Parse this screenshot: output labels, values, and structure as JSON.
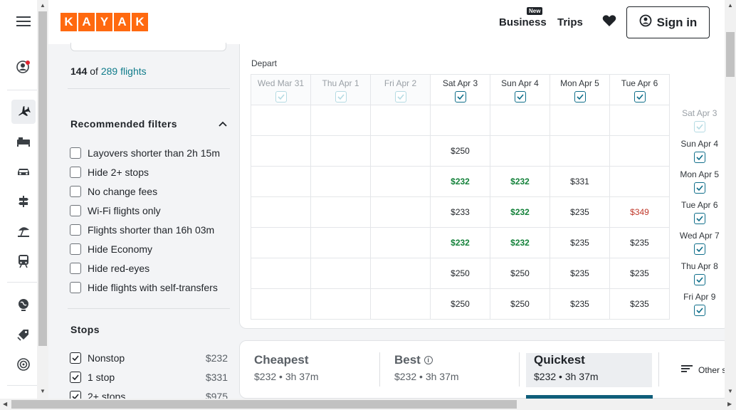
{
  "header": {
    "logo_letters": [
      "K",
      "A",
      "Y",
      "A",
      "K"
    ],
    "business_label": "Business",
    "new_badge": "New",
    "trips_label": "Trips",
    "signin_label": "Sign in"
  },
  "rail": {
    "icons": [
      "menu-icon",
      "account-icon",
      "flight-icon",
      "hotel-icon",
      "car-icon",
      "packages-icon",
      "beach-icon",
      "train-icon",
      "explore-icon",
      "deals-icon",
      "trips-radar-icon"
    ]
  },
  "filters": {
    "count_num": "144",
    "count_of": "of",
    "count_link": "289 flights",
    "recommended_title": "Recommended filters",
    "recommended": [
      {
        "label": "Layovers shorter than 2h 15m",
        "checked": false
      },
      {
        "label": "Hide 2+ stops",
        "checked": false
      },
      {
        "label": "No change fees",
        "checked": false
      },
      {
        "label": "Wi-Fi flights only",
        "checked": false
      },
      {
        "label": "Flights shorter than 16h 03m",
        "checked": false
      },
      {
        "label": "Hide Economy",
        "checked": false
      },
      {
        "label": "Hide red-eyes",
        "checked": false
      },
      {
        "label": "Hide flights with self-transfers",
        "checked": false
      }
    ],
    "stops_title": "Stops",
    "stops": [
      {
        "label": "Nonstop",
        "price": "$232",
        "checked": true
      },
      {
        "label": "1 stop",
        "price": "$331",
        "checked": true
      },
      {
        "label": "2+ stops",
        "price": "$975",
        "checked": true
      }
    ]
  },
  "calendar": {
    "depart_label": "Depart",
    "columns": [
      {
        "label": "Wed Mar 31",
        "enabled": false
      },
      {
        "label": "Thu Apr 1",
        "enabled": false
      },
      {
        "label": "Fri Apr 2",
        "enabled": false
      },
      {
        "label": "Sat Apr 3",
        "enabled": true
      },
      {
        "label": "Sun Apr 4",
        "enabled": true
      },
      {
        "label": "Mon Apr 5",
        "enabled": true
      },
      {
        "label": "Tue Apr 6",
        "enabled": true
      }
    ],
    "rows": [
      {
        "label": "Sat Apr 3",
        "enabled": false,
        "cells": [
          "",
          "",
          "",
          "",
          "",
          "",
          ""
        ]
      },
      {
        "label": "Sun Apr 4",
        "enabled": true,
        "cells": [
          "",
          "",
          "",
          "$250",
          "",
          "",
          ""
        ]
      },
      {
        "label": "Mon Apr 5",
        "enabled": true,
        "cells": [
          "",
          "",
          "",
          "$232",
          "$232",
          "$331",
          ""
        ]
      },
      {
        "label": "Tue Apr 6",
        "enabled": true,
        "cells": [
          "",
          "",
          "",
          "$233",
          "$232",
          "$235",
          "$349"
        ]
      },
      {
        "label": "Wed Apr 7",
        "enabled": true,
        "cells": [
          "",
          "",
          "",
          "$232",
          "$232",
          "$235",
          "$235"
        ]
      },
      {
        "label": "Thu Apr 8",
        "enabled": true,
        "cells": [
          "",
          "",
          "",
          "$250",
          "$250",
          "$235",
          "$235"
        ]
      },
      {
        "label": "Fri Apr 9",
        "enabled": true,
        "cells": [
          "",
          "",
          "",
          "$250",
          "$250",
          "$235",
          "$235"
        ]
      }
    ],
    "cheap_price": "$232",
    "high_price": "$349"
  },
  "sort": {
    "tabs": [
      {
        "title": "Cheapest",
        "sub": "$232 • 3h 37m",
        "active": false
      },
      {
        "title": "Best",
        "sub": "$232 • 3h 37m",
        "active": false
      },
      {
        "title": "Quickest",
        "sub": "$232 • 3h 37m",
        "active": true
      }
    ],
    "other_label": "Other s"
  },
  "colors": {
    "brand": "#ff690f",
    "accent": "#0f5e7a",
    "cheap": "#14813a",
    "expensive": "#c0392b",
    "link": "#0f7b8a"
  }
}
